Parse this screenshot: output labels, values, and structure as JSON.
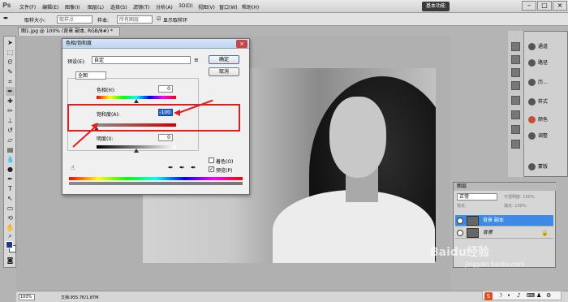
{
  "menubar": {
    "logo": "Ps",
    "items": [
      "文件(F)",
      "编辑(E)",
      "图像(I)",
      "图层(L)",
      "选择(S)",
      "滤镜(T)",
      "分析(A)",
      "3D(D)",
      "视图(V)",
      "窗口(W)",
      "帮助(H)"
    ],
    "workspace": "基本功能",
    "win_min": "–",
    "win_max": "□",
    "win_close": "×"
  },
  "options": {
    "sample_size_label": "取样大小:",
    "sample_size_value": "取样点",
    "sample_label": "样本:",
    "sample_value": "所有图层",
    "show_ring": "显示取样环"
  },
  "document": {
    "tab": "图1.jpg @ 100% (背景 副本, RGB/8#) *"
  },
  "status": {
    "zoom": "100%",
    "info": "文档:955.7K/1.87M"
  },
  "dock": {
    "items": [
      "通道",
      "路径",
      "历...",
      "样式",
      "颜色",
      "调整",
      "蒙版"
    ]
  },
  "layers_panel": {
    "tab": "图层",
    "blend": "正常",
    "opacity": "不透明度: 100%",
    "lock": "锁定:",
    "fill": "填充: 100%",
    "layers": [
      "背景 副本",
      "背景"
    ]
  },
  "dialog": {
    "title": "色相/饱和度",
    "preset_label": "预设(E):",
    "preset_value": "自定",
    "ok": "确定",
    "cancel": "取消",
    "channel": "全图",
    "hue_label": "色相(H):",
    "hue_value": "0",
    "saturation_label": "饱和度(A):",
    "saturation_value": "-100",
    "lightness_label": "明度(I):",
    "lightness_value": "0",
    "colorize_label": "着色(O)",
    "preview_label": "预览(P)"
  },
  "watermark": {
    "text": "Baidu经验",
    "url": "jingyan.baidu.com"
  },
  "ime": {
    "logo": "S"
  },
  "colors": {
    "highlight": "#e21d1d",
    "accent": "#2d6bd8"
  }
}
